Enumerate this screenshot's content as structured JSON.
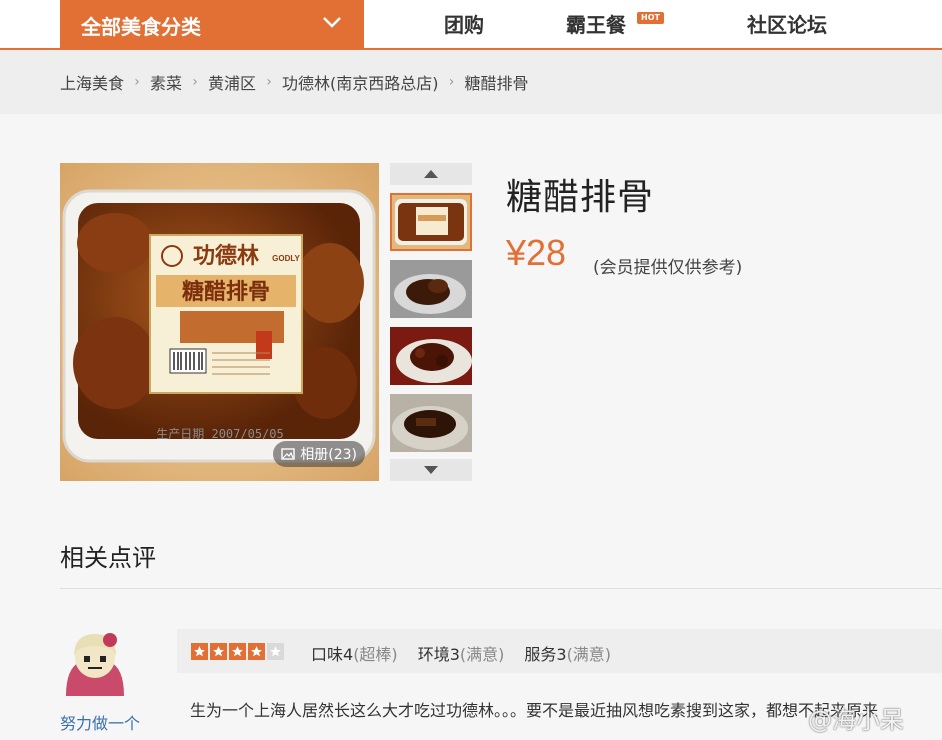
{
  "nav": {
    "category_label": "全部美食分类",
    "links": [
      "团购",
      "霸王餐",
      "社区论坛"
    ],
    "hot_badge": "HOT",
    "accent": "#e26f34"
  },
  "breadcrumb": [
    "上海美食",
    "素菜",
    "黄浦区",
    "功德林(南京西路总店)",
    "糖醋排骨"
  ],
  "gallery": {
    "album_label": "相册(23)",
    "package_brand": "功德林",
    "package_brand_en": "GODLY",
    "package_product": "糖醋排骨",
    "package_date": "生产日期 2007/05/05"
  },
  "dish": {
    "name": "糖醋排骨",
    "price": "¥28",
    "price_note": "(会员提供仅供参考)"
  },
  "reviews": {
    "section_title": "相关点评",
    "user": "努力做一个",
    "star_rating": 4,
    "star_max": 5,
    "taste": "口味4",
    "taste_sub": "(超棒)",
    "env": "环境3",
    "env_sub": "(满意)",
    "service": "服务3",
    "service_sub": "(满意)",
    "text": "生为一个上海人居然长这么大才吃过功德林。。。要不是最近抽风想吃素搜到这家，都想不起来原来"
  },
  "watermark": "@海小呆"
}
